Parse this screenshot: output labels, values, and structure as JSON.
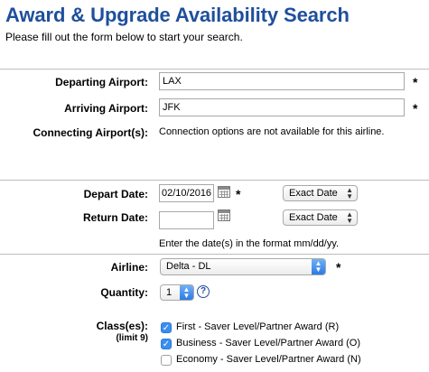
{
  "page": {
    "title": "Award & Upgrade Availability Search",
    "subtitle": "Please fill out the form below to start your search."
  },
  "airports": {
    "departing_label": "Departing Airport:",
    "departing_value": "LAX",
    "arriving_label": "Arriving Airport:",
    "arriving_value": "JFK",
    "connecting_label": "Connecting Airport(s):",
    "connecting_note": "Connection options are not available for this airline."
  },
  "dates": {
    "depart_label": "Depart Date:",
    "depart_value": "02/10/2016",
    "depart_mode": "Exact Date",
    "return_label": "Return Date:",
    "return_value": "",
    "return_mode": "Exact Date",
    "format_hint": "Enter the date(s) in the format mm/dd/yy."
  },
  "airline": {
    "label": "Airline:",
    "value": "Delta - DL"
  },
  "quantity": {
    "label": "Quantity:",
    "value": "1",
    "help": "?"
  },
  "classes": {
    "label": "Class(es):",
    "limit": "(limit 9)",
    "options": [
      {
        "label": "First - Saver Level/Partner Award (R)",
        "checked": true
      },
      {
        "label": "Business - Saver Level/Partner Award (O)",
        "checked": true
      },
      {
        "label": "Economy - Saver Level/Partner Award (N)",
        "checked": false
      }
    ]
  },
  "required_mark": "*",
  "icons": {
    "calendar": "calendar-icon",
    "check": "✓",
    "chevron": "▲▼"
  },
  "colors": {
    "title": "#1f4f9c",
    "checkbox_on": "#3b8ef0",
    "select_arrow": "#2c7be5"
  }
}
